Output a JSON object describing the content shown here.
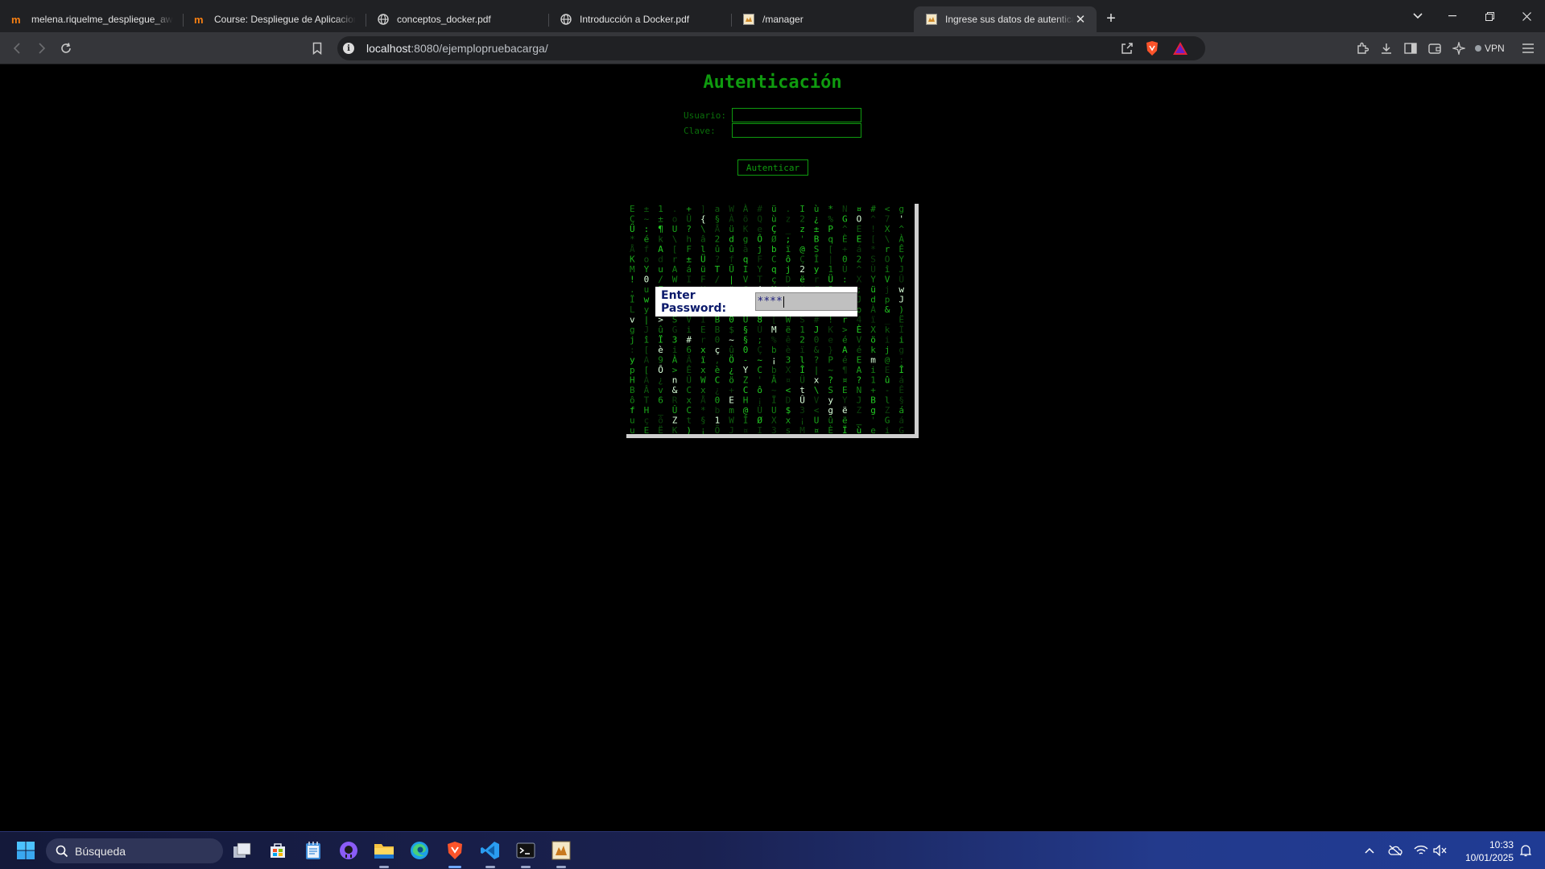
{
  "browser": {
    "tabs": [
      {
        "title": "melena.riquelme_despliegue_aw: Pr",
        "favicon": "moodle-icon",
        "active": false
      },
      {
        "title": "Course: Despliegue de Aplicaciones",
        "favicon": "moodle-icon",
        "active": false
      },
      {
        "title": "conceptos_docker.pdf",
        "favicon": "globe-icon",
        "active": false
      },
      {
        "title": "Introducción a Docker.pdf",
        "favicon": "globe-icon",
        "active": false
      },
      {
        "title": "/manager",
        "favicon": "tomcat-icon",
        "active": false
      },
      {
        "title": "Ingrese sus datos de autenticac",
        "favicon": "tomcat-icon",
        "active": true
      }
    ],
    "url_host": "localhost",
    "url_rest": ":8080/ejemplopruebacarga/",
    "vpn_label": "VPN"
  },
  "page": {
    "title": "Autenticación",
    "username_label": "Usuario:",
    "password_label": "Clave:",
    "submit_label": "Autenticar",
    "applet": {
      "prompt_label": "Enter Password:",
      "password_value": "****"
    }
  },
  "taskbar": {
    "search_placeholder": "Búsqueda",
    "time": "10:33",
    "date": "10/01/2025"
  },
  "colors": {
    "terminal_green": "#0f9b0f",
    "accent_blue": "#0b1a6b"
  }
}
